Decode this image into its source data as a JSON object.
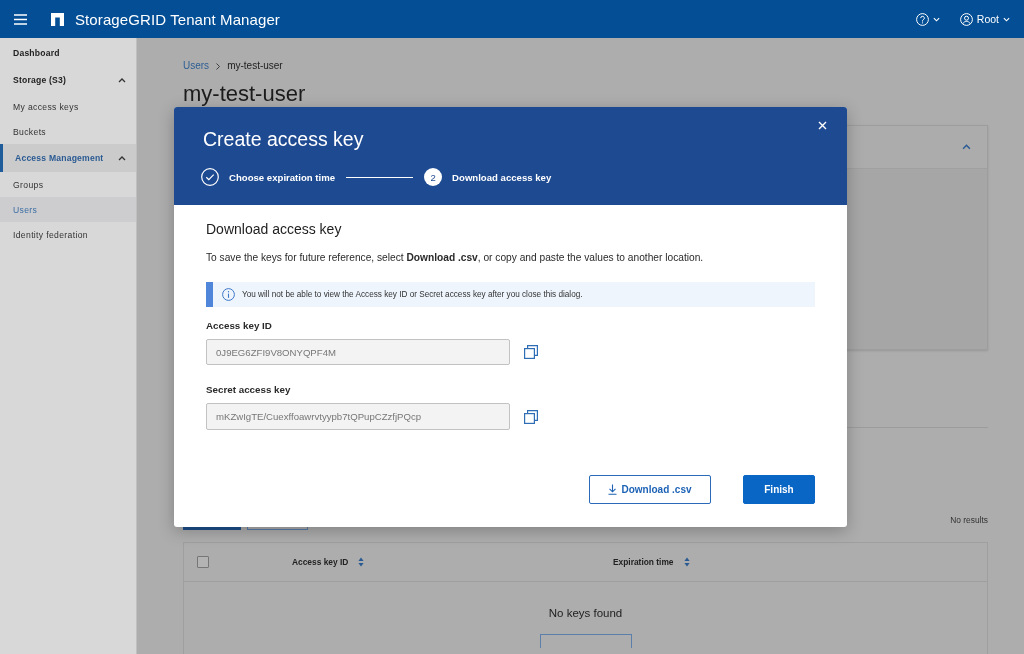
{
  "app_bar": {
    "title": "StorageGRID Tenant Manager",
    "user": "Root"
  },
  "sidebar": {
    "items": [
      {
        "kind": "link",
        "label": "Dashboard",
        "selected": false
      },
      {
        "kind": "group",
        "label": "Storage (S3)",
        "selected": false,
        "expanded": true,
        "children": [
          {
            "label": "My access keys",
            "selected": false
          },
          {
            "label": "Buckets",
            "selected": false
          }
        ]
      },
      {
        "kind": "group",
        "label": "Access Management",
        "selected": true,
        "expanded": true,
        "children": [
          {
            "label": "Groups",
            "selected": false
          },
          {
            "label": "Users",
            "selected": true
          },
          {
            "label": "Identity federation",
            "selected": false
          }
        ]
      }
    ]
  },
  "breadcrumb": [
    {
      "kind": "link",
      "label": "Users"
    },
    {
      "kind": "current",
      "label": "my-test-user"
    }
  ],
  "page_title": "my-test-user",
  "panel": {
    "expanded": true
  },
  "results_count": "No results",
  "table": {
    "select_all": {
      "checked": false
    },
    "columns": [
      {
        "label": "Access key ID",
        "sortable": true
      },
      {
        "label": "Expiration time",
        "sortable": true
      }
    ],
    "empty_message": "No keys found"
  },
  "dialog": {
    "title": "Create access key",
    "steps": [
      {
        "label": "Choose expiration time",
        "complete": true
      },
      {
        "number": "2",
        "label": "Download access key",
        "complete": false
      }
    ],
    "heading": "Download access key",
    "description": "To save the keys for future reference, select **Download .csv**, or copy and paste the values to another location.",
    "alert": {
      "kind": "info",
      "text": "You will not be able to view the Access key ID or Secret access key after you close this dialog."
    },
    "fields": [
      {
        "label": "Access key ID",
        "value": "0J9EG6ZFI9V8ONYQPF4M"
      },
      {
        "label": "Secret access key",
        "value": "mKZwIgTE/Cuexffoawrvtyypb7tQPupCZzfjPQcp"
      }
    ],
    "buttons": [
      {
        "kind": "download",
        "label": "Download .csv"
      },
      {
        "kind": "primary",
        "label": "Finish"
      }
    ]
  }
}
